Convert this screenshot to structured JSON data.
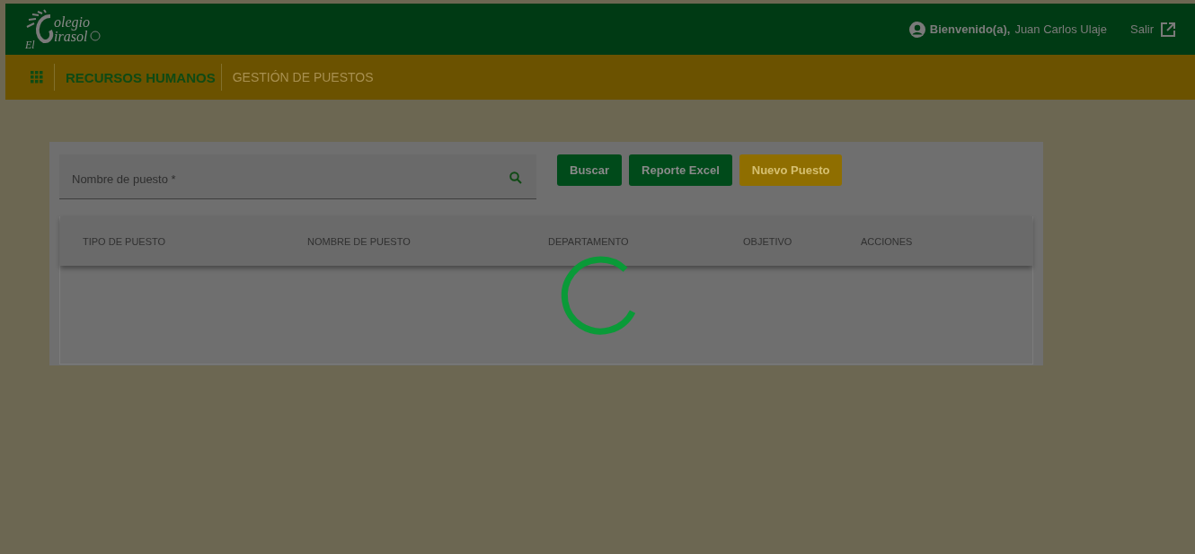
{
  "logo": {
    "line_1": "olegio",
    "line_2_prefix": "El",
    "line_2": "irasol"
  },
  "header": {
    "user_greeting": "Bienvenido(a),",
    "user_name": "Juan Carlos Ulaje",
    "logout": "Salir"
  },
  "breadcrumb": [
    {
      "label": "RECURSOS HUMANOS",
      "selected": true
    },
    {
      "label": "GESTIÓN DE PUESTOS",
      "selected": false
    }
  ],
  "search": {
    "placeholder": "Nombre de puesto *"
  },
  "buttons": [
    {
      "label": "Buscar",
      "kind": "primary"
    },
    {
      "label": "Reporte Excel",
      "kind": "primary"
    },
    {
      "label": "Nuevo Puesto",
      "kind": "accent"
    }
  ],
  "table": {
    "columns": [
      "TIPO DE PUESTO",
      "NOMBRE DE PUESTO",
      "DEPARTAMENTO",
      "OBJETIVO",
      "ACCIONES"
    ]
  },
  "loading": true
}
